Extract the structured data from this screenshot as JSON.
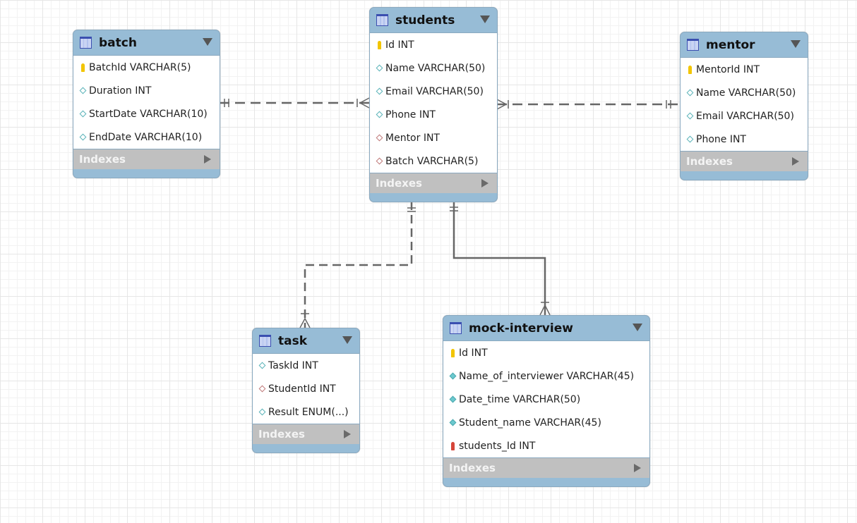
{
  "tables": {
    "batch": {
      "name": "batch",
      "indexes_label": "Indexes",
      "columns": [
        {
          "text": "BatchId VARCHAR(5)",
          "icon": "pk"
        },
        {
          "text": "Duration INT",
          "icon": "col"
        },
        {
          "text": "StartDate VARCHAR(10)",
          "icon": "col"
        },
        {
          "text": "EndDate VARCHAR(10)",
          "icon": "col"
        }
      ]
    },
    "students": {
      "name": "students",
      "indexes_label": "Indexes",
      "columns": [
        {
          "text": "Id INT",
          "icon": "pk"
        },
        {
          "text": "Name VARCHAR(50)",
          "icon": "col"
        },
        {
          "text": "Email VARCHAR(50)",
          "icon": "col"
        },
        {
          "text": "Phone INT",
          "icon": "col"
        },
        {
          "text": "Mentor INT",
          "icon": "fk"
        },
        {
          "text": "Batch VARCHAR(5)",
          "icon": "fk"
        }
      ]
    },
    "mentor": {
      "name": "mentor",
      "indexes_label": "Indexes",
      "columns": [
        {
          "text": "MentorId INT",
          "icon": "pk"
        },
        {
          "text": "Name VARCHAR(50)",
          "icon": "col"
        },
        {
          "text": "Email VARCHAR(50)",
          "icon": "col"
        },
        {
          "text": "Phone INT",
          "icon": "col"
        }
      ]
    },
    "task": {
      "name": "task",
      "indexes_label": "Indexes",
      "columns": [
        {
          "text": "TaskId INT",
          "icon": "col"
        },
        {
          "text": "StudentId INT",
          "icon": "fk"
        },
        {
          "text": "Result ENUM(...)",
          "icon": "col"
        }
      ]
    },
    "mock_interview": {
      "name": "mock-interview",
      "indexes_label": "Indexes",
      "columns": [
        {
          "text": "Id INT",
          "icon": "pk"
        },
        {
          "text": "Name_of_interviewer VARCHAR(45)",
          "icon": "nn"
        },
        {
          "text": "Date_time VARCHAR(50)",
          "icon": "nn"
        },
        {
          "text": "Student_name VARCHAR(45)",
          "icon": "nn"
        },
        {
          "text": "students_Id INT",
          "icon": "fkpk"
        }
      ]
    }
  },
  "relationships": [
    {
      "from": "batch",
      "to": "students",
      "from_card": "one-and-only-one",
      "to_card": "one-or-many",
      "style": "dashed"
    },
    {
      "from": "mentor",
      "to": "students",
      "from_card": "one-and-only-one",
      "to_card": "one-or-many",
      "style": "dashed"
    },
    {
      "from": "students",
      "to": "task",
      "from_card": "one-and-only-one",
      "to_card": "one-or-many",
      "style": "dashed"
    },
    {
      "from": "students",
      "to": "mock-interview",
      "from_card": "one-and-only-one",
      "to_card": "one-or-many",
      "style": "solid"
    }
  ],
  "colors": {
    "header": "#97bcd6",
    "indexes": "#c0c0c0",
    "line": "#666666"
  }
}
